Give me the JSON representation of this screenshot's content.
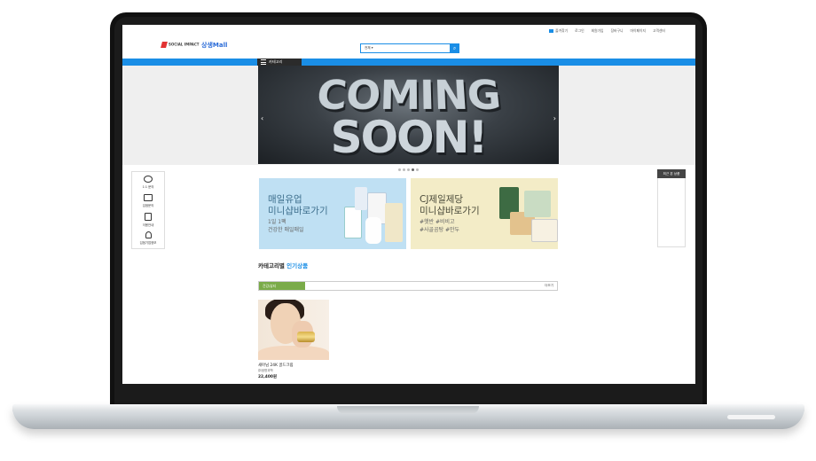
{
  "top_nav": {
    "items": [
      "즐겨찾기",
      "로그인",
      "회원가입",
      "장바구니",
      "마이페이지",
      "고객센터"
    ]
  },
  "brand": {
    "partner_logo": "SOCIAL IMPACT",
    "mall_logo": "상생Mall"
  },
  "search": {
    "category_option": "전체",
    "button_icon": "search-icon"
  },
  "category_menu": {
    "label": "카테고리"
  },
  "hero": {
    "line1": "COMING",
    "line2": "SOON!",
    "prev_arrow": "‹",
    "next_arrow": "›",
    "slide_count": 5,
    "active_slide": 4
  },
  "left_quick_menu": {
    "items": [
      {
        "label": "1:1 문의",
        "icon": "chat-icon"
      },
      {
        "label": "입점문의",
        "icon": "store-icon"
      },
      {
        "label": "이용안내",
        "icon": "clipboard-icon"
      },
      {
        "label": "입점기업정보",
        "icon": "lightbulb-icon"
      }
    ]
  },
  "recent_items": {
    "label": "최근 본 상품"
  },
  "banners": [
    {
      "title_line1": "매일유업",
      "title_line2": "미니샵바로가기",
      "sub_line1": "1일 1팩",
      "sub_line2": "건강한 매일매일"
    },
    {
      "title_line1": "CJ제일제당",
      "title_line2": "미니샵바로가기",
      "sub_line1": "#햇반 #비비고",
      "sub_line2": "#사골곰탕 #만두"
    }
  ],
  "section": {
    "title_prefix": "카테고리별",
    "title_highlight": "인기상품",
    "active_tab": "건강/뷰티",
    "more_label": "더보기"
  },
  "product": {
    "name": "새아님 24K 골드크림",
    "brand": "㈜생명과학",
    "price": "22,400원"
  },
  "colors": {
    "accent": "#1a8ee6",
    "tab_green": "#7aab49"
  }
}
